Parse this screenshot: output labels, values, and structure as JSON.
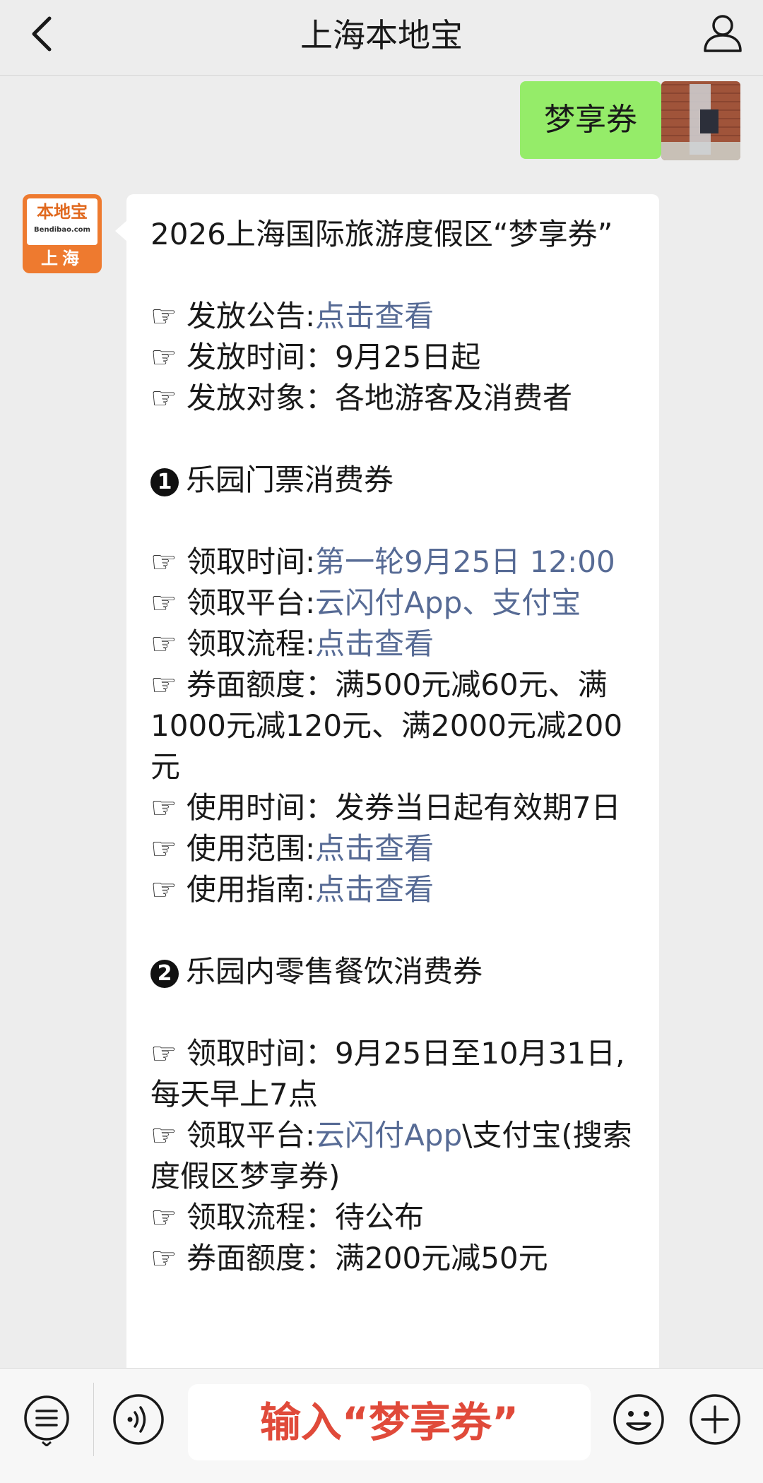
{
  "header": {
    "title": "上海本地宝"
  },
  "messages": {
    "outgoing": "梦享券",
    "bot_avatar": {
      "line1": "本地宝",
      "line2": "Bendibao.com",
      "line3": "上海"
    }
  },
  "article": {
    "title": "2026上海国际旅游度假区“梦享券”",
    "hand": "☞",
    "intro": [
      {
        "label": "发放公告:",
        "value": "点击查看",
        "is_link": true
      },
      {
        "label": "发放时间：",
        "value": "9月25日起",
        "is_link": false
      },
      {
        "label": "发放对象：",
        "value": "各地游客及消费者",
        "is_link": false
      }
    ],
    "section1": {
      "num": "1",
      "title": "乐园门票消费券",
      "items": [
        {
          "label": "领取时间:",
          "link": "第一轮9月25日 12:00",
          "rest": ""
        },
        {
          "label": "领取平台:",
          "link": "云闪付App、支付宝",
          "rest": ""
        },
        {
          "label": "领取流程:",
          "link": "点击查看",
          "rest": ""
        },
        {
          "label": "券面额度：",
          "link": "",
          "rest": "满500元减60元、满1000元减120元、满2000元减200元"
        },
        {
          "label": "使用时间：",
          "link": "",
          "rest": "发券当日起有效期7日"
        },
        {
          "label": "使用范围:",
          "link": "点击查看",
          "rest": ""
        },
        {
          "label": "使用指南:",
          "link": "点击查看",
          "rest": ""
        }
      ]
    },
    "section2": {
      "num": "2",
      "title": "乐园内零售餐饮消费券",
      "items": [
        {
          "label": "领取时间：",
          "link": "",
          "rest": "9月25日至10月31日,每天早上7点"
        },
        {
          "label": "领取平台:",
          "link": "云闪付App",
          "rest": "\\支付宝(搜索度假区梦享券)"
        },
        {
          "label": "领取流程：",
          "link": "",
          "rest": "待公布"
        },
        {
          "label": "券面额度：",
          "link": "",
          "rest": "满200元减50元"
        }
      ]
    }
  },
  "toolbar": {
    "input_overlay": "输入“梦享券”",
    "icons": [
      "menu-icon",
      "voice-icon",
      "emoji-icon",
      "plus-icon"
    ]
  }
}
